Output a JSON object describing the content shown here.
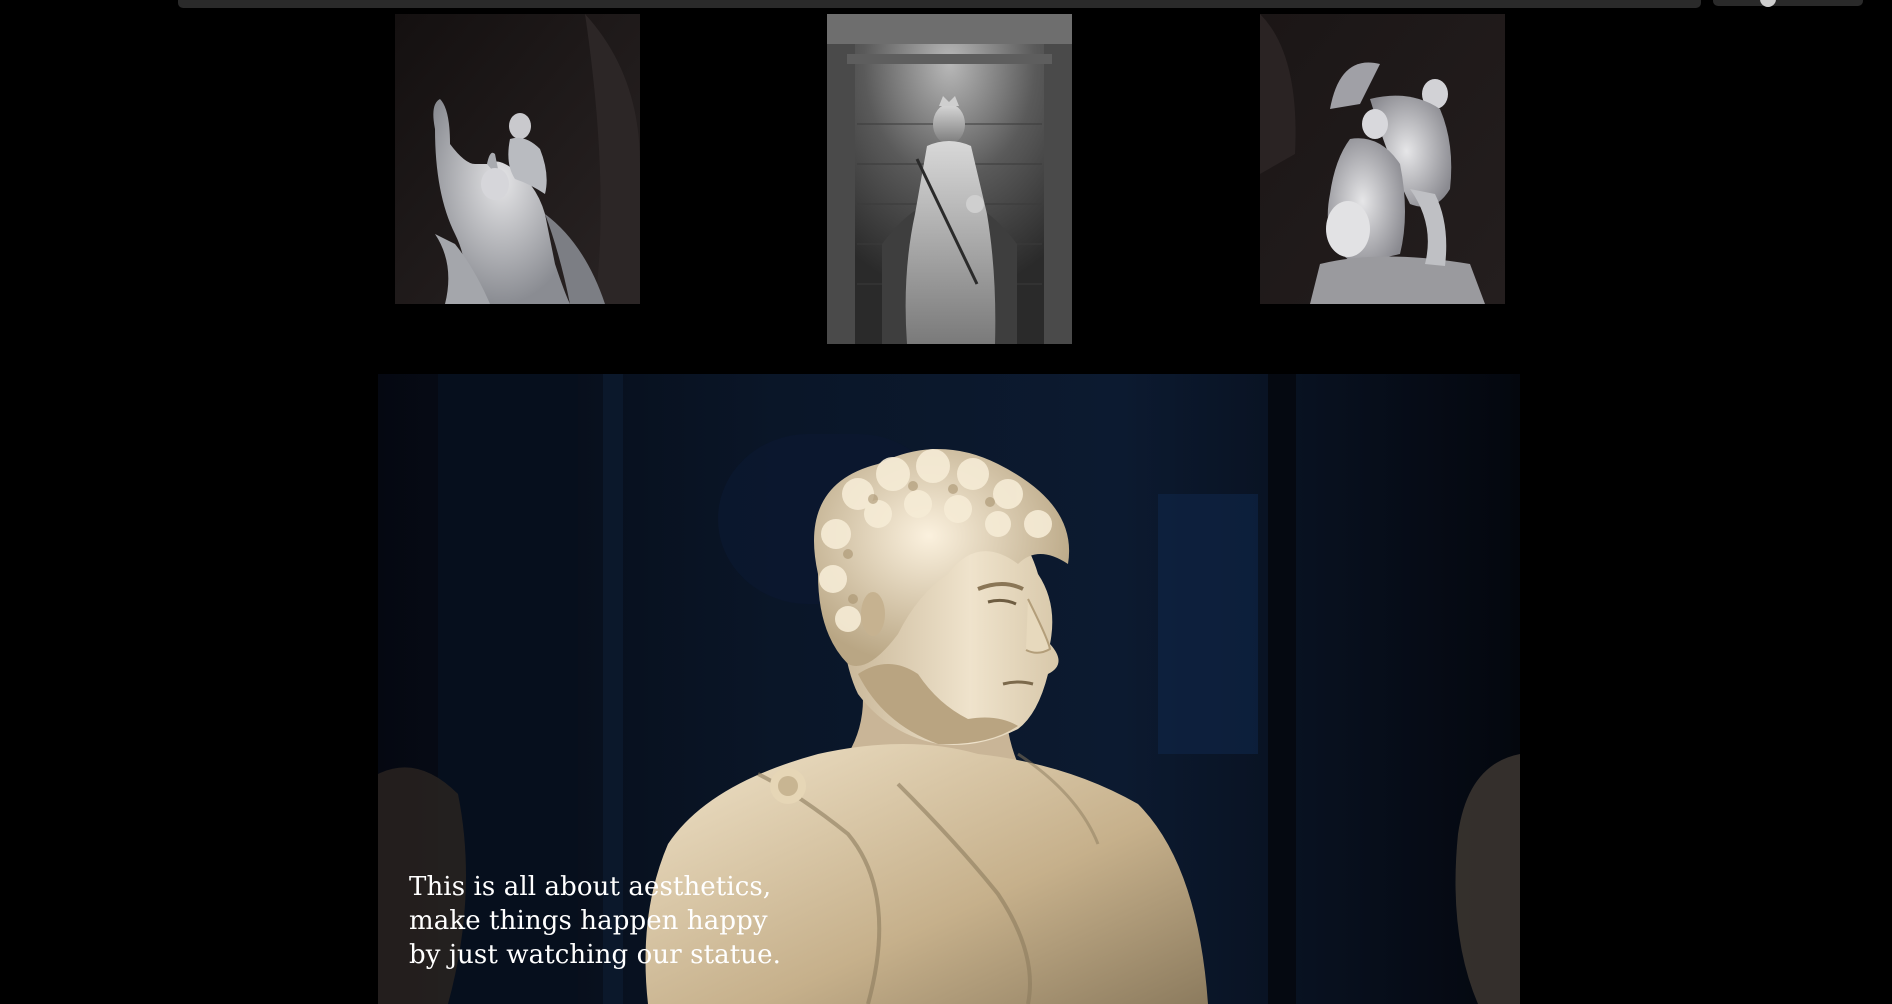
{
  "gallery": {
    "thumbnails": [
      {
        "name": "statue-thumb-left"
      },
      {
        "name": "statue-thumb-center"
      },
      {
        "name": "statue-thumb-right"
      }
    ]
  },
  "hero": {
    "caption_lines": [
      "This is all about aesthetics,",
      "make things happen happy",
      "by just watching our statue."
    ]
  },
  "colors": {
    "background": "#000000",
    "hero_bg": "#07101f",
    "marble": "#e8dcc4",
    "caption": "#ffffff"
  }
}
